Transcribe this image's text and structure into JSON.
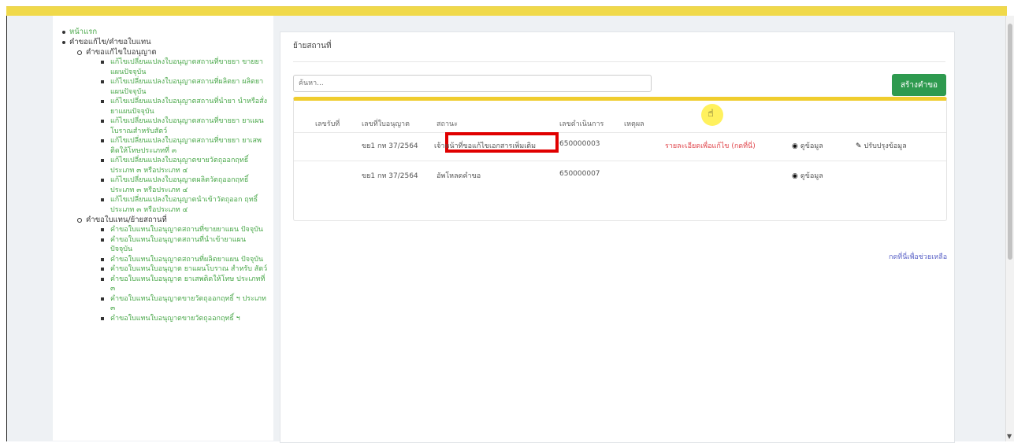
{
  "sidebar": {
    "home": "หน้าแรก",
    "group1": "คำขอแก้ไข/คำขอใบแทน",
    "sub1": "คำขอแก้ไขใบอนุญาต",
    "sub1_items": [
      "แก้ไขเปลี่ยนแปลงใบอนุญาตสถานที่ขายยา ขายยาแผนปัจจุบัน",
      "แก้ไขเปลี่ยนแปลงใบอนุญาตสถานที่ผลิตยา ผลิตยาแผนปัจจุบัน",
      "แก้ไขเปลี่ยนแปลงใบอนุญาตสถานที่นำยา นำหรือสั่งยาแผนปัจจุบัน",
      "แก้ไขเปลี่ยนแปลงใบอนุญาตสถานที่ขายยา ยาแผนโบราณสำหรับสัตว์",
      "แก้ไขเปลี่ยนแปลงใบอนุญาตสถานที่ขายยา ยาเสพติดให้โทษประเภทที่ ๓",
      "แก้ไขเปลี่ยนแปลงใบอนุญาตขายวัตถุออกฤทธิ์ ประเภท ๓ หรือประเภท ๔",
      "แก้ไขเปลี่ยนแปลงใบอนุญาตผลิตวัตถุออกฤทธิ์ ประเภท ๓ หรือประเภท ๔",
      "แก้ไขเปลี่ยนแปลงใบอนุญาตนำเข้าวัตถุออก ฤทธิ์ ประเภท ๓ หรือประเภท ๔"
    ],
    "sub2": "คำขอใบแทน/ย้ายสถานที่",
    "sub2_items": [
      "คำขอใบแทนใบอนุญาตสถานที่ขายยาแผน ปัจจุบัน",
      "คำขอใบแทนใบอนุญาตสถานที่นำเข้ายาแผน ปัจจุบัน",
      "คำขอใบแทนใบอนุญาตสถานที่ผลิตยาแผน ปัจจุบัน",
      "คำขอใบแทนใบอนุญาต ยาแผนโบราณ สำหรับ สัตว์",
      "คำขอใบแทนใบอนุญาต ยาเสพติดให้โทษ ประเภทที่ ๓",
      "คำขอใบแทนใบอนุญาตขายวัตถุออกฤทธิ์ ฯ ประเภท ๓",
      "คำขอใบแทนใบอนุญาตขายวัตถุออกฤทธิ์ ฯ"
    ]
  },
  "main": {
    "title": "ย้ายสถานที่",
    "search_placeholder": "ค้นหา...",
    "create_button": "สร้างคำขอ",
    "columns": [
      "เลขรับที่",
      "เลขที่ใบอนุญาต",
      "สถานะ",
      "เลขดำเนินการ",
      "เหตุผล"
    ],
    "rows": [
      {
        "receive_no": "",
        "license_no": "ขย1 กท 37/2564",
        "status": "เจ้าหน้าที่ขอแก้ไขเอกสารเพิ่มเติม",
        "process_no": "650000003",
        "reason": "",
        "detail_link": "รายละเอียดเพื่อแก้ไข (กดที่นี่)",
        "view": "ดูข้อมูล",
        "edit": "ปรับปรุงข้อมูล"
      },
      {
        "receive_no": "",
        "license_no": "ขย1 กท 37/2564",
        "status": "อัพโหลดคำขอ",
        "process_no": "650000007",
        "reason": "",
        "detail_link": "",
        "view": "ดูข้อมูล",
        "edit": ""
      }
    ],
    "help_link": "กดที่นี่เพื่อช่วยเหลือ"
  },
  "colors": {
    "topbar": "#f0d94a",
    "primary_button": "#2e9a4f",
    "sidebar_link": "#4aa84a",
    "alert_link": "#e0454b",
    "highlight_box": "#e00000"
  },
  "icons": [
    "eye-icon",
    "pencil-icon",
    "hand-cursor-icon"
  ]
}
